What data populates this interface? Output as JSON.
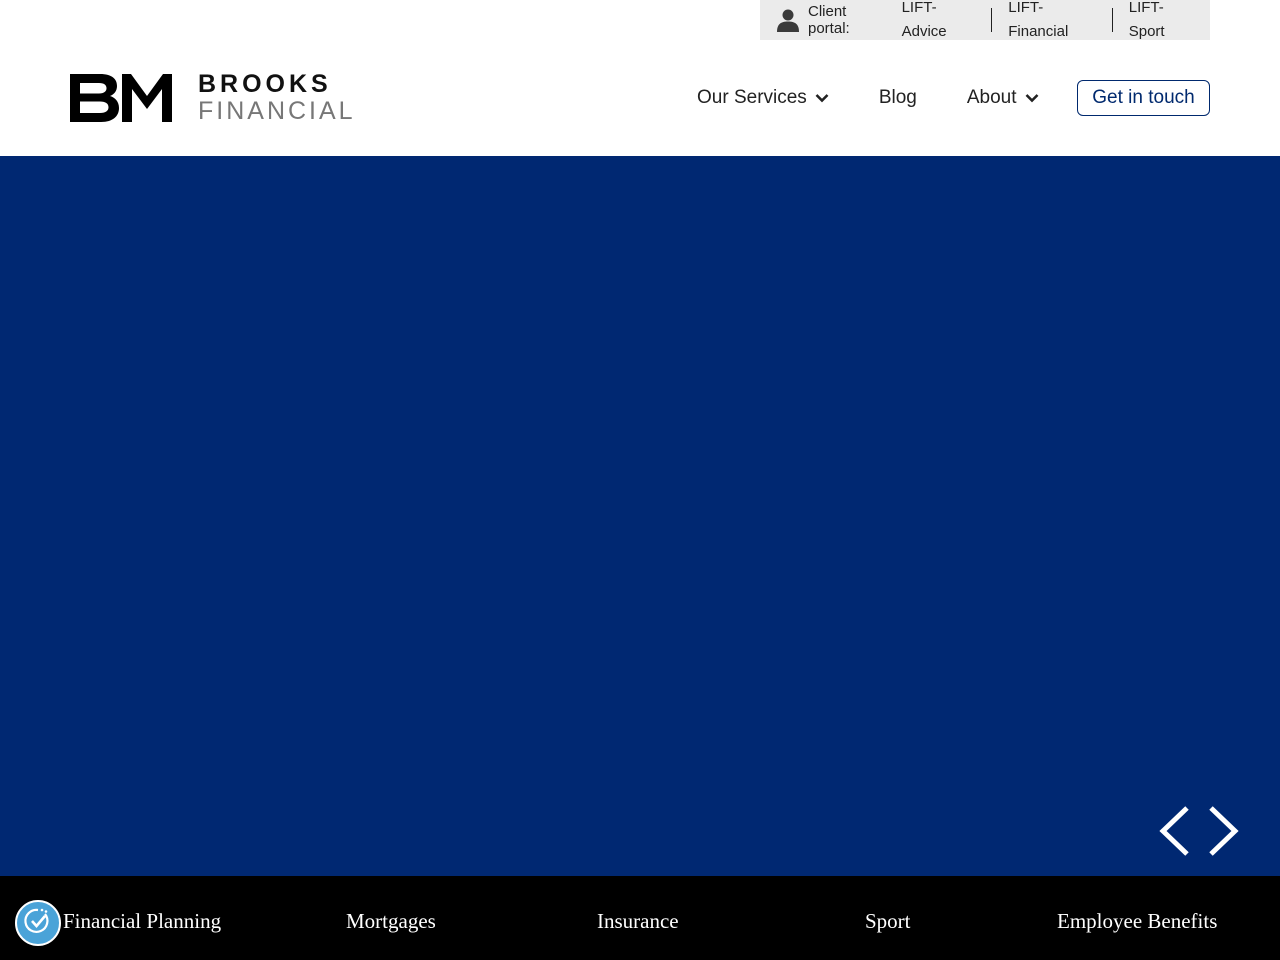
{
  "portal": {
    "label": "Client portal:",
    "links": [
      "LIFT-Advice",
      "LIFT-Financial",
      "LIFT-Sport"
    ]
  },
  "brand": {
    "line1": "BROOKS",
    "line2": "FINANCIAL",
    "mark": "BM"
  },
  "nav": {
    "items": [
      {
        "label": "Our Services",
        "has_dropdown": true
      },
      {
        "label": "Blog",
        "has_dropdown": false
      },
      {
        "label": "About",
        "has_dropdown": true
      }
    ],
    "cta_label": "Get in touch"
  },
  "hero": {
    "background_color": "#002872",
    "controls": {
      "prev_icon": "chevron-left-icon",
      "next_icon": "chevron-right-icon"
    }
  },
  "services": [
    "Financial Planning",
    "Mortgages",
    "Insurance",
    "Sport",
    "Employee Benefits"
  ],
  "colors": {
    "accent": "#00296e",
    "portal_bar": "#ebebeb",
    "footer": "#000000",
    "a11y_button": "#4aa3d8"
  },
  "icons": {
    "user": "user-icon",
    "chevron_down": "chevron-down-icon",
    "accessibility": "accessibility-icon"
  }
}
